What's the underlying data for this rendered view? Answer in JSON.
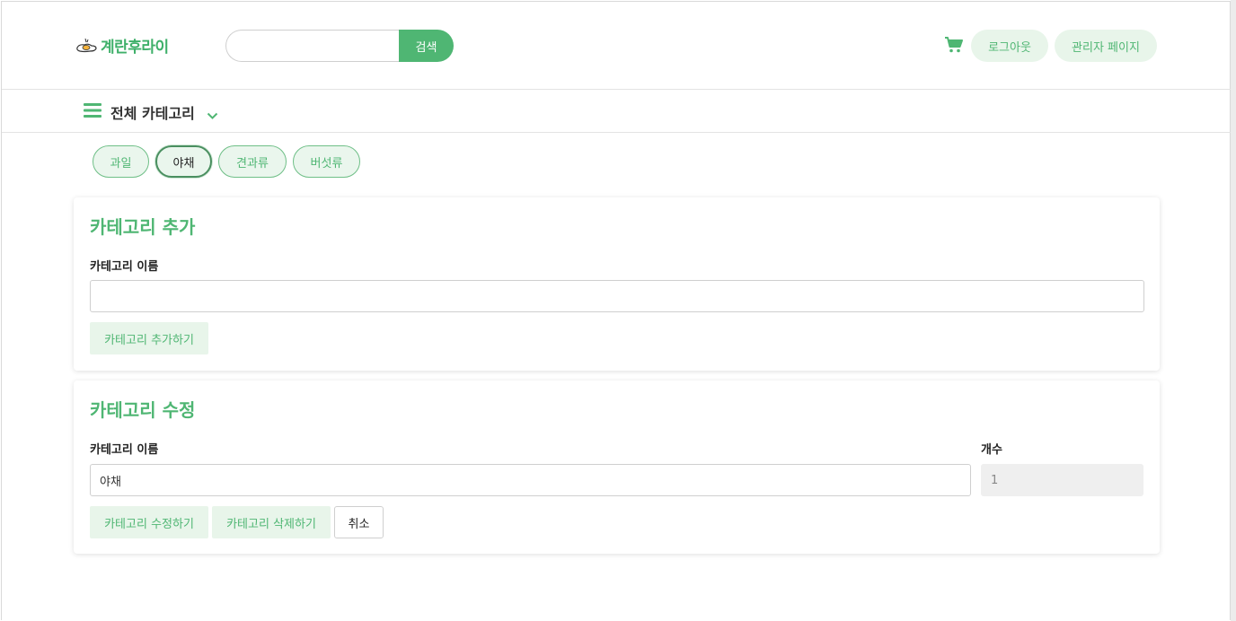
{
  "header": {
    "logo_text": "계란후라이",
    "search": {
      "value": "",
      "placeholder": "",
      "button_label": "검색"
    },
    "cart_icon": "cart-icon",
    "logout_label": "로그아웃",
    "admin_label": "관리자 페이지"
  },
  "category_bar": {
    "label": "전체 카테고리",
    "menu_icon": "hamburger-icon",
    "dropdown_icon": "chevron-down-icon"
  },
  "categories": [
    {
      "label": "과일",
      "active": false
    },
    {
      "label": "야채",
      "active": true
    },
    {
      "label": "견과류",
      "active": false
    },
    {
      "label": "버섯류",
      "active": false
    }
  ],
  "add_card": {
    "title": "카테고리 추가",
    "name_label": "카테고리 이름",
    "name_value": "",
    "add_button": "카테고리 추가하기"
  },
  "edit_card": {
    "title": "카테고리 수정",
    "name_label": "카테고리 이름",
    "name_value": "야채",
    "count_label": "개수",
    "count_value": "1",
    "edit_button": "카테고리 수정하기",
    "delete_button": "카테고리 삭제하기",
    "cancel_button": "취소"
  },
  "colors": {
    "accent": "#4fb673",
    "accent_light": "#e8f5ea",
    "border": "#cfcfcf"
  }
}
